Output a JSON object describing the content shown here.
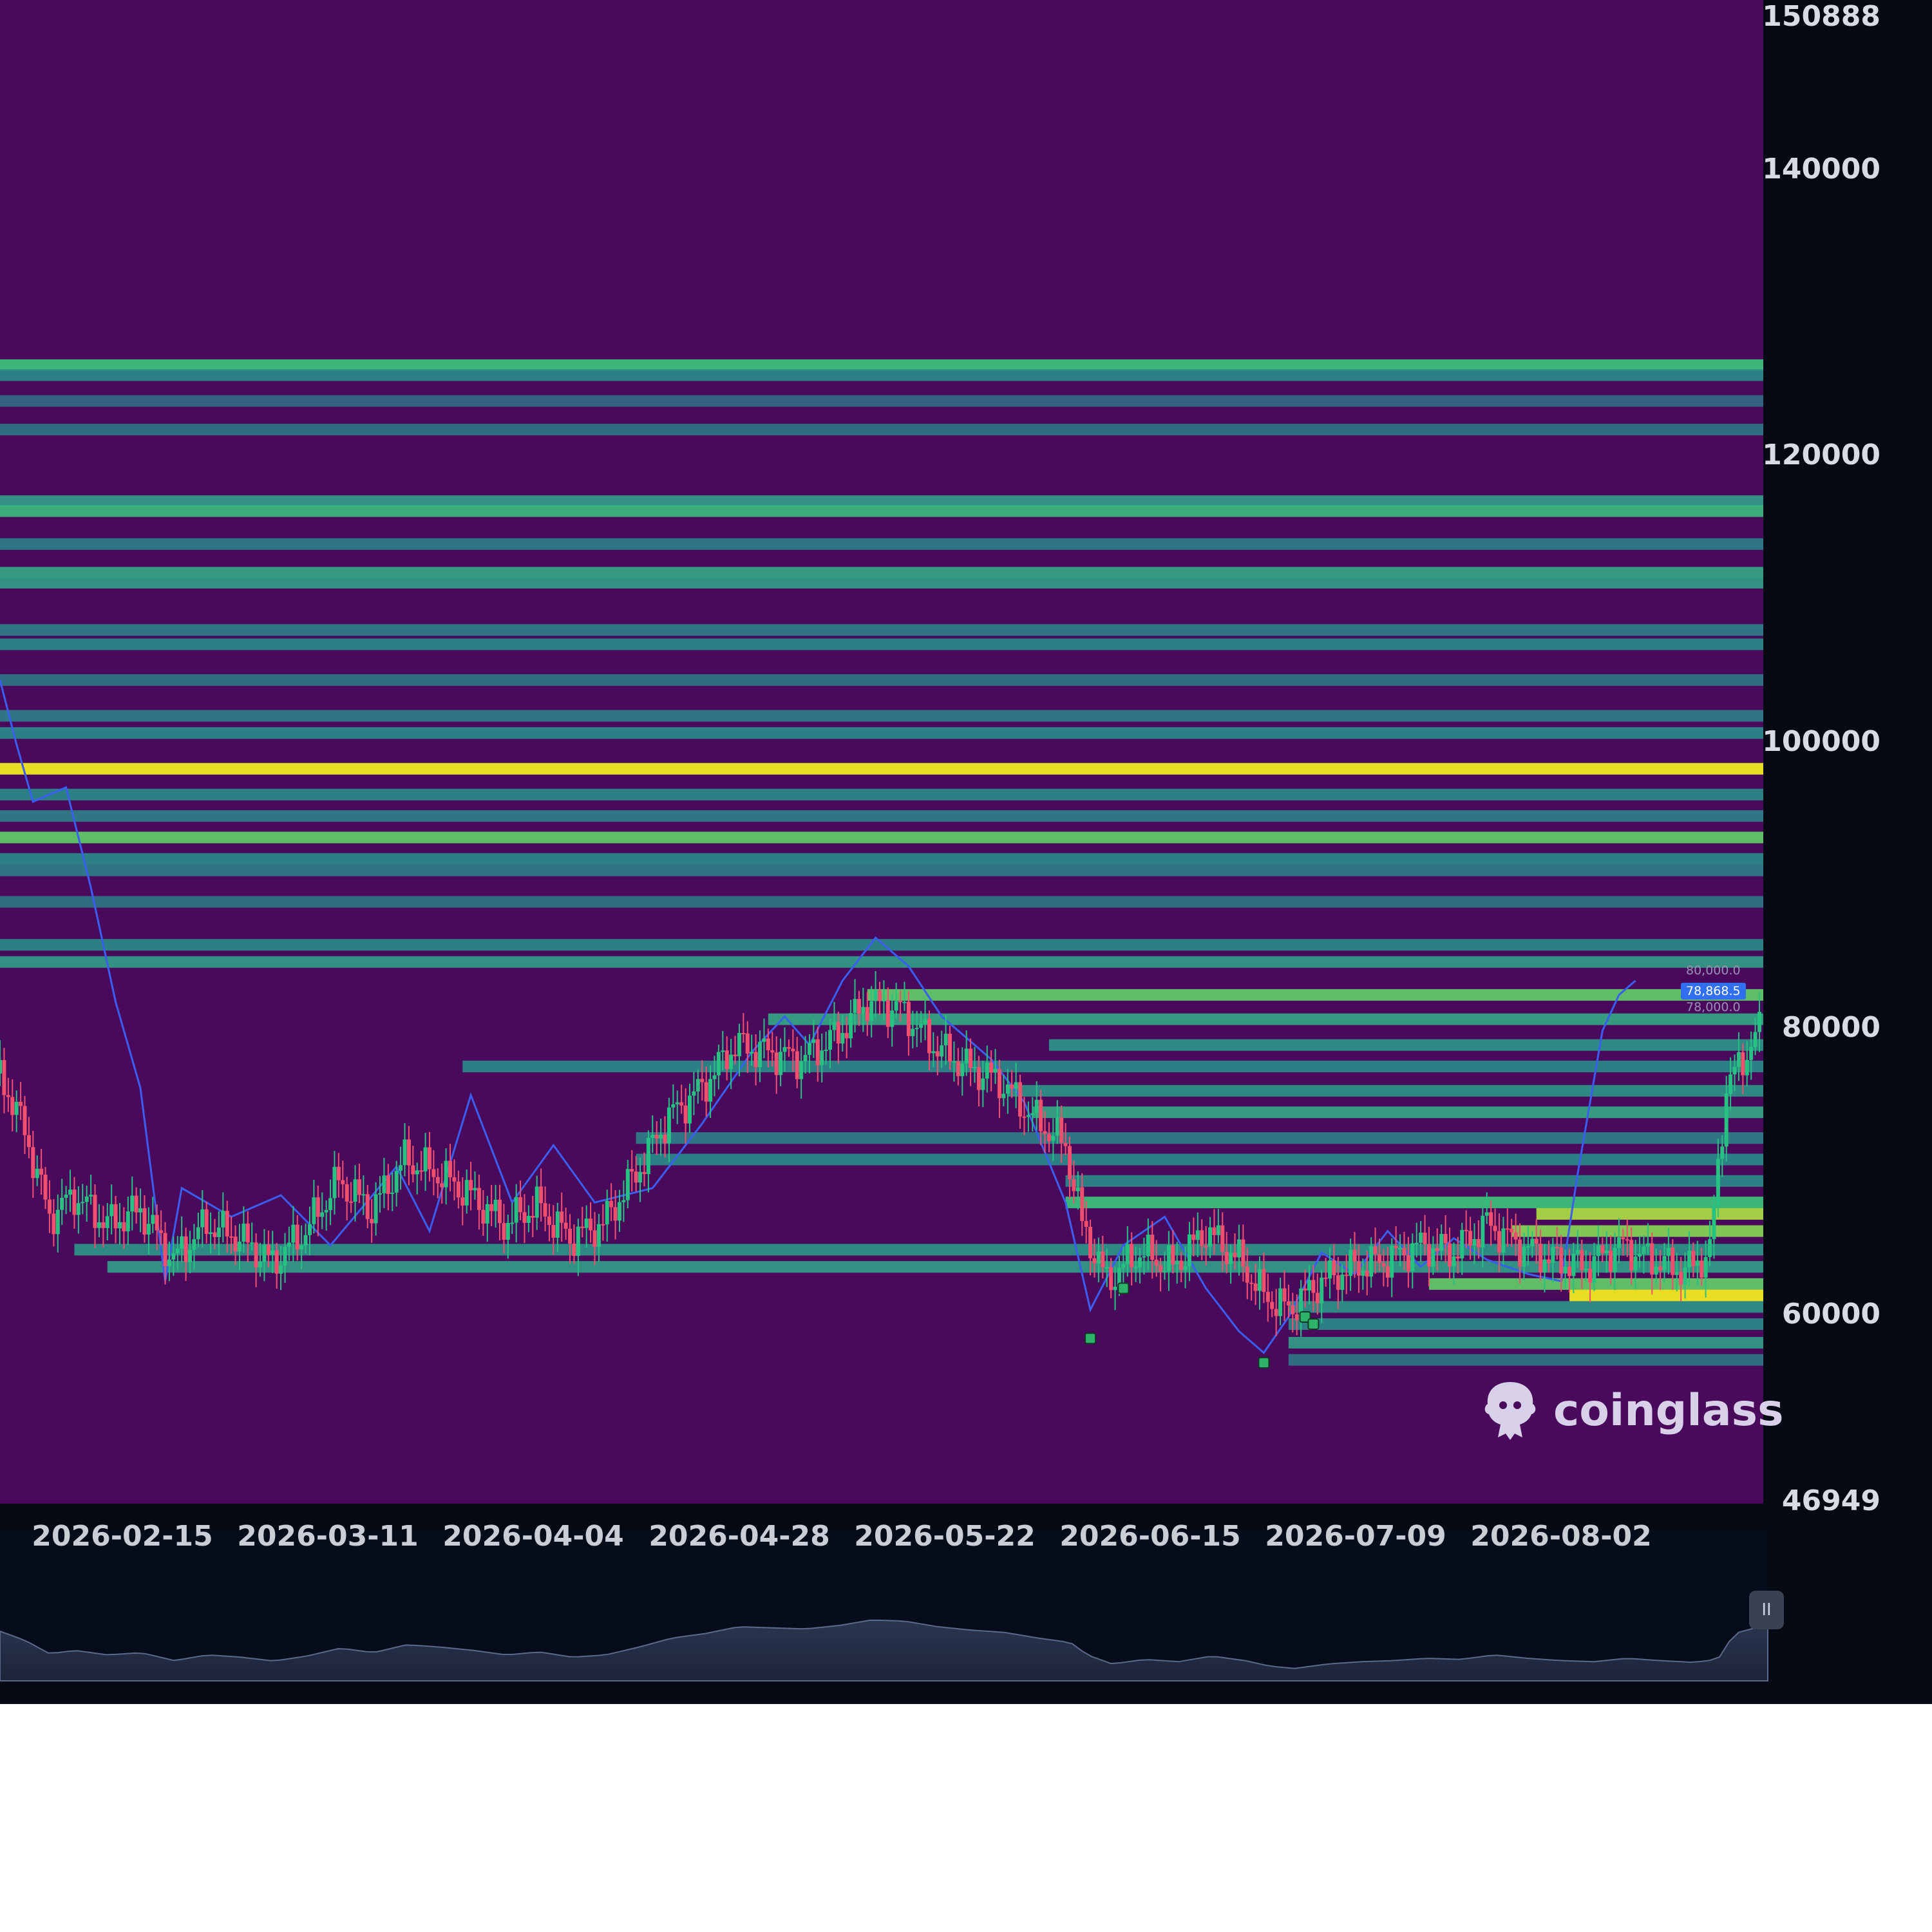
{
  "y_axis": {
    "labels": [
      "150888",
      "140000",
      "120000",
      "100000",
      "80000",
      "60000",
      "46949"
    ]
  },
  "x_axis": {
    "labels": [
      "2026-02-15",
      "2026-03-11",
      "2026-04-04",
      "2026-04-28",
      "2026-05-22",
      "2026-06-15",
      "2026-07-09",
      "2026-08-02"
    ]
  },
  "price_tags": {
    "upper": "80,000.0",
    "current": "78,868.5",
    "lower": "78,000.0"
  },
  "watermark": {
    "text": "coinglass",
    "icon": "coinglass-logo-icon"
  },
  "navigator": {
    "handle_icon": "pause-handle-icon",
    "handle_glyph": "II"
  },
  "colors": {
    "background": "#4a0a5c",
    "heat_low": "#3e2a78",
    "heat_mid": "#2a8a8a",
    "heat_high": "#3cc47a",
    "heat_max": "#f5f01e",
    "candle_up": "#26c281",
    "candle_down": "#f0506e",
    "line": "#3a5ef0"
  },
  "chart_data": {
    "type": "heatmap",
    "title": "",
    "xlabel": "",
    "ylabel": "",
    "ylim": [
      46949,
      150888
    ],
    "x_ticks": [
      "2026-02-15",
      "2026-03-11",
      "2026-04-04",
      "2026-04-28",
      "2026-05-22",
      "2026-06-15",
      "2026-07-09",
      "2026-08-02"
    ],
    "date_range": [
      "2026-01-23",
      "2026-08-24"
    ],
    "heat_bands": [
      {
        "price": 126500,
        "intensity": 0.75
      },
      {
        "price": 125800,
        "intensity": 0.45
      },
      {
        "price": 124000,
        "intensity": 0.3
      },
      {
        "price": 122000,
        "intensity": 0.35
      },
      {
        "price": 117000,
        "intensity": 0.55
      },
      {
        "price": 116300,
        "intensity": 0.7
      },
      {
        "price": 114000,
        "intensity": 0.4
      },
      {
        "price": 112000,
        "intensity": 0.6
      },
      {
        "price": 111300,
        "intensity": 0.55
      },
      {
        "price": 108000,
        "intensity": 0.4
      },
      {
        "price": 107000,
        "intensity": 0.45
      },
      {
        "price": 104500,
        "intensity": 0.35
      },
      {
        "price": 102000,
        "intensity": 0.4
      },
      {
        "price": 100800,
        "intensity": 0.45
      },
      {
        "price": 98300,
        "intensity": 1.0
      },
      {
        "price": 96500,
        "intensity": 0.45
      },
      {
        "price": 95000,
        "intensity": 0.4
      },
      {
        "price": 93500,
        "intensity": 0.8
      },
      {
        "price": 92000,
        "intensity": 0.45
      },
      {
        "price": 91200,
        "intensity": 0.4
      },
      {
        "price": 89000,
        "intensity": 0.35
      },
      {
        "price": 86000,
        "intensity": 0.45
      },
      {
        "price": 84800,
        "intensity": 0.55,
        "start": "2026-01-23"
      },
      {
        "price": 82500,
        "intensity": 0.8,
        "start": "2026-05-08"
      },
      {
        "price": 80800,
        "intensity": 0.6,
        "start": "2026-04-26"
      },
      {
        "price": 79000,
        "intensity": 0.5,
        "start": "2026-05-30"
      },
      {
        "price": 77500,
        "intensity": 0.45,
        "start": "2026-03-20"
      },
      {
        "price": 75800,
        "intensity": 0.5,
        "start": "2026-05-25"
      },
      {
        "price": 74300,
        "intensity": 0.6,
        "start": "2026-05-28"
      },
      {
        "price": 72500,
        "intensity": 0.4,
        "start": "2026-04-10"
      },
      {
        "price": 71000,
        "intensity": 0.45,
        "start": "2026-04-10"
      },
      {
        "price": 69500,
        "intensity": 0.45,
        "start": "2026-06-01"
      },
      {
        "price": 68000,
        "intensity": 0.75,
        "start": "2026-06-01"
      },
      {
        "price": 67200,
        "intensity": 0.9,
        "start": "2026-07-28"
      },
      {
        "price": 66000,
        "intensity": 0.85,
        "start": "2026-07-25"
      },
      {
        "price": 64700,
        "intensity": 0.5,
        "start": "2026-02-01"
      },
      {
        "price": 63500,
        "intensity": 0.55,
        "start": "2026-02-05"
      },
      {
        "price": 62300,
        "intensity": 0.8,
        "start": "2026-07-15"
      },
      {
        "price": 61500,
        "intensity": 1.0,
        "start": "2026-08-01"
      },
      {
        "price": 60700,
        "intensity": 0.5,
        "start": "2026-06-28"
      },
      {
        "price": 59500,
        "intensity": 0.45,
        "start": "2026-06-28"
      },
      {
        "price": 58200,
        "intensity": 0.55,
        "start": "2026-06-28"
      },
      {
        "price": 57000,
        "intensity": 0.35,
        "start": "2026-06-28"
      }
    ],
    "price_series": {
      "name": "",
      "points": [
        [
          "2026-01-23",
          77000
        ],
        [
          "2026-01-26",
          73000
        ],
        [
          "2026-01-29",
          67000
        ],
        [
          "2026-02-01",
          68500
        ],
        [
          "2026-02-05",
          66500
        ],
        [
          "2026-02-09",
          67500
        ],
        [
          "2026-02-13",
          64000
        ],
        [
          "2026-02-17",
          66500
        ],
        [
          "2026-02-21",
          65500
        ],
        [
          "2026-02-25",
          63800
        ],
        [
          "2026-03-01",
          66000
        ],
        [
          "2026-03-05",
          69500
        ],
        [
          "2026-03-09",
          67500
        ],
        [
          "2026-03-13",
          71000
        ],
        [
          "2026-03-17",
          70000
        ],
        [
          "2026-03-21",
          68500
        ],
        [
          "2026-03-25",
          66500
        ],
        [
          "2026-03-29",
          67800
        ],
        [
          "2026-04-02",
          65500
        ],
        [
          "2026-04-06",
          66500
        ],
        [
          "2026-04-10",
          70000
        ],
        [
          "2026-04-14",
          74000
        ],
        [
          "2026-04-18",
          76000
        ],
        [
          "2026-04-22",
          79000
        ],
        [
          "2026-04-26",
          78500
        ],
        [
          "2026-04-30",
          78000
        ],
        [
          "2026-05-04",
          79500
        ],
        [
          "2026-05-08",
          82000
        ],
        [
          "2026-05-12",
          81500
        ],
        [
          "2026-05-16",
          79000
        ],
        [
          "2026-05-20",
          77500
        ],
        [
          "2026-05-24",
          76500
        ],
        [
          "2026-05-28",
          74000
        ],
        [
          "2026-06-01",
          72000
        ],
        [
          "2026-06-03",
          66500
        ],
        [
          "2026-06-06",
          62500
        ],
        [
          "2026-06-10",
          64500
        ],
        [
          "2026-06-14",
          63500
        ],
        [
          "2026-06-18",
          66000
        ],
        [
          "2026-06-22",
          64000
        ],
        [
          "2026-06-25",
          61500
        ],
        [
          "2026-06-28",
          60500
        ],
        [
          "2026-07-02",
          62500
        ],
        [
          "2026-07-06",
          63500
        ],
        [
          "2026-07-10",
          64000
        ],
        [
          "2026-07-14",
          65000
        ],
        [
          "2026-07-18",
          64500
        ],
        [
          "2026-07-22",
          66500
        ],
        [
          "2026-07-26",
          65000
        ],
        [
          "2026-07-30",
          64000
        ],
        [
          "2026-08-03",
          63500
        ],
        [
          "2026-08-07",
          65000
        ],
        [
          "2026-08-11",
          64000
        ],
        [
          "2026-08-15",
          63200
        ],
        [
          "2026-08-18",
          64500
        ],
        [
          "2026-08-19",
          70500
        ],
        [
          "2026-08-20",
          76000
        ],
        [
          "2026-08-22",
          78000
        ],
        [
          "2026-08-24",
          80000
        ]
      ]
    },
    "overlay_line": {
      "name": "",
      "points": [
        [
          "2026-01-23",
          104500
        ],
        [
          "2026-01-25",
          100000
        ],
        [
          "2026-01-27",
          96000
        ],
        [
          "2026-01-31",
          97000
        ],
        [
          "2026-02-03",
          90000
        ],
        [
          "2026-02-06",
          82000
        ],
        [
          "2026-02-09",
          76000
        ],
        [
          "2026-02-12",
          62500
        ],
        [
          "2026-02-14",
          69000
        ],
        [
          "2026-02-20",
          67000
        ],
        [
          "2026-02-26",
          68500
        ],
        [
          "2026-03-04",
          65000
        ],
        [
          "2026-03-12",
          70500
        ],
        [
          "2026-03-16",
          66000
        ],
        [
          "2026-03-21",
          75500
        ],
        [
          "2026-03-26",
          68000
        ],
        [
          "2026-03-31",
          72000
        ],
        [
          "2026-04-05",
          68000
        ],
        [
          "2026-04-12",
          69000
        ],
        [
          "2026-04-18",
          73500
        ],
        [
          "2026-04-24",
          78500
        ],
        [
          "2026-04-28",
          81000
        ],
        [
          "2026-05-01",
          79000
        ],
        [
          "2026-05-05",
          83500
        ],
        [
          "2026-05-09",
          86500
        ],
        [
          "2026-05-13",
          84500
        ],
        [
          "2026-05-17",
          81000
        ],
        [
          "2026-05-23",
          78000
        ],
        [
          "2026-05-27",
          75000
        ],
        [
          "2026-06-01",
          68000
        ],
        [
          "2026-06-04",
          60500
        ],
        [
          "2026-06-08",
          65000
        ],
        [
          "2026-06-13",
          67000
        ],
        [
          "2026-06-18",
          62000
        ],
        [
          "2026-06-22",
          59000
        ],
        [
          "2026-06-25",
          57500
        ],
        [
          "2026-06-28",
          60000
        ],
        [
          "2026-07-02",
          64500
        ],
        [
          "2026-07-06",
          63000
        ],
        [
          "2026-07-10",
          66000
        ],
        [
          "2026-07-14",
          63500
        ],
        [
          "2026-07-18",
          65500
        ],
        [
          "2026-07-22",
          64000
        ],
        [
          "2026-07-27",
          63000
        ],
        [
          "2026-07-31",
          62500
        ],
        [
          "2026-08-02",
          70000
        ],
        [
          "2026-08-05",
          80000
        ],
        [
          "2026-08-07",
          82500
        ],
        [
          "2026-08-09",
          83500
        ]
      ]
    },
    "markers": [
      {
        "date": "2026-06-04",
        "price": 58500
      },
      {
        "date": "2026-06-08",
        "price": 62000
      },
      {
        "date": "2026-06-25",
        "price": 56800
      },
      {
        "date": "2026-06-30",
        "price": 60000
      },
      {
        "date": "2026-07-01",
        "price": 59500
      }
    ]
  }
}
